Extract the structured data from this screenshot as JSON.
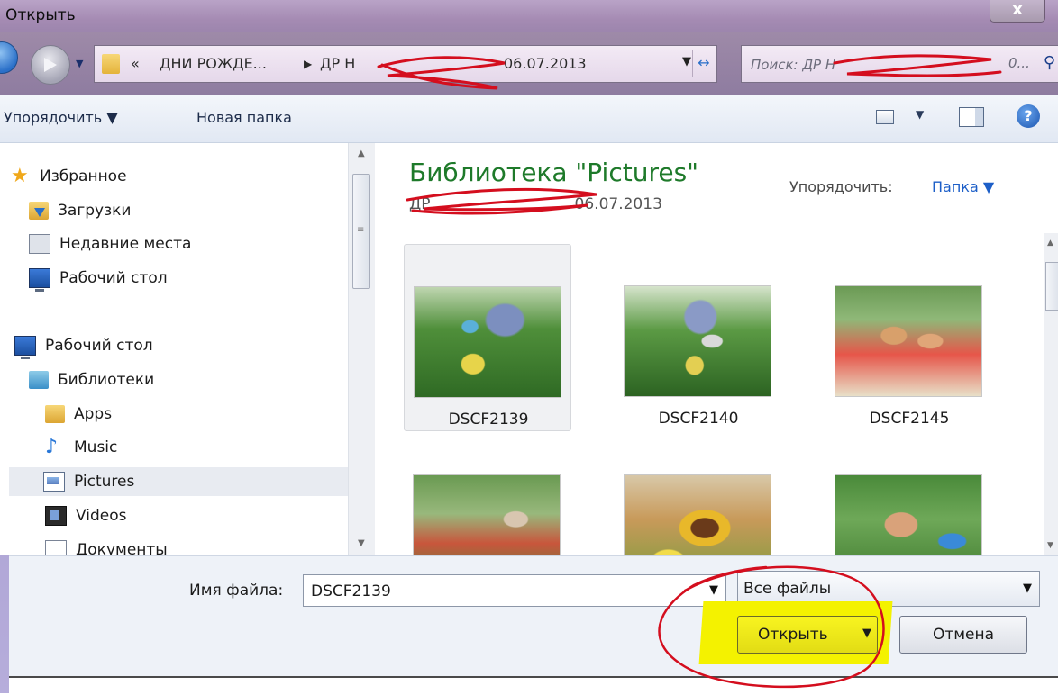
{
  "window": {
    "title": "Открыть",
    "close_label": "x"
  },
  "address": {
    "prefix": "«",
    "crumbs": [
      "ДНИ РОЖДЕ...",
      "ДР Н",
      "06.07.2013"
    ],
    "search_placeholder": "Поиск: ДР Н",
    "search_suffix": "0..."
  },
  "toolbar": {
    "organize": "Упорядочить ▼",
    "new_folder": "Новая папка",
    "help": "?"
  },
  "nav": {
    "favorites": "Избранное",
    "downloads": "Загрузки",
    "recent": "Недавние места",
    "desktop_fav": "Рабочий стол",
    "desktop": "Рабочий стол",
    "libraries": "Библиотеки",
    "apps": "Apps",
    "music": "Music",
    "pictures": "Pictures",
    "videos": "Videos",
    "documents": "Документы"
  },
  "content": {
    "title": "Библиотека \"Pictures\"",
    "subtitle_prefix": "ДР",
    "subtitle_suffix": "06.07.2013",
    "arrange_label": "Упорядочить:",
    "arrange_value": "Папка ▼",
    "files": [
      "DSCF2139",
      "DSCF2140",
      "DSCF2145"
    ]
  },
  "bottom": {
    "filename_label": "Имя файла:",
    "filename_value": "DSCF2139",
    "filetype_value": "Все файлы",
    "open_label": "Открыть",
    "cancel_label": "Отмена"
  },
  "icons": {
    "dropdown": "▼",
    "up": "▲",
    "down": "▼",
    "search": "⚲",
    "refresh": "↔",
    "grip": "≡"
  },
  "colors": {
    "title_green": "#1e7a2a",
    "link_blue": "#1d5fc8",
    "highlight_yellow": "#f4f200",
    "annotation_red": "#d40e1e"
  }
}
